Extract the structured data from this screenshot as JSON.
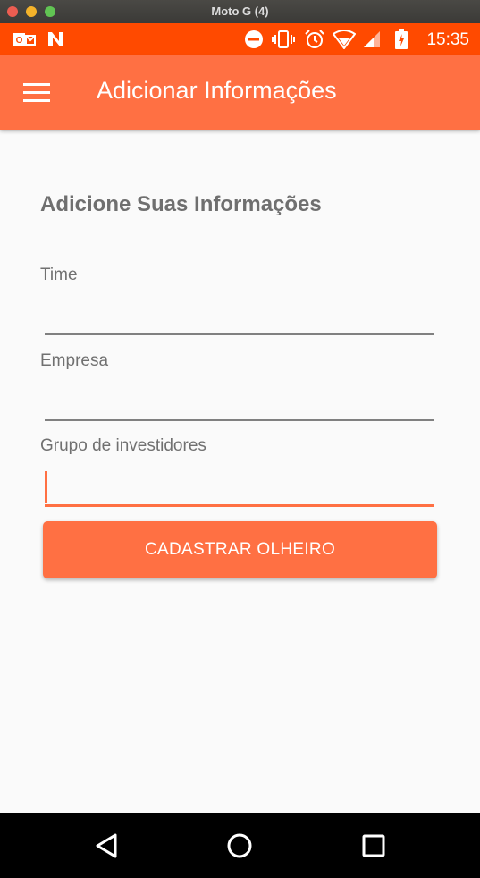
{
  "window": {
    "title": "Moto G (4)",
    "buttons": [
      "close",
      "minimize",
      "maximize"
    ]
  },
  "statusbar": {
    "time": "15:35",
    "icons": [
      "outlook-icon",
      "n-app-icon",
      "do-not-disturb-icon",
      "vibrate-icon",
      "alarm-icon",
      "wifi-icon",
      "signal-icon",
      "battery-charging-icon"
    ]
  },
  "appbar": {
    "menu_icon": "hamburger-menu-icon",
    "title": "Adicionar Informações"
  },
  "form": {
    "heading": "Adicione Suas Informações",
    "fields": [
      {
        "label": "Time",
        "value": ""
      },
      {
        "label": "Empresa",
        "value": ""
      },
      {
        "label": "Grupo de investidores",
        "value": "",
        "focused": true
      }
    ],
    "submit_label": "CADASTRAR OLHEIRO"
  },
  "navbar": {
    "icons": [
      "back-icon",
      "home-icon",
      "recents-icon"
    ]
  },
  "colors": {
    "accent": "#ff7043",
    "statusbar": "#ff4a00",
    "nav": "#000000"
  }
}
